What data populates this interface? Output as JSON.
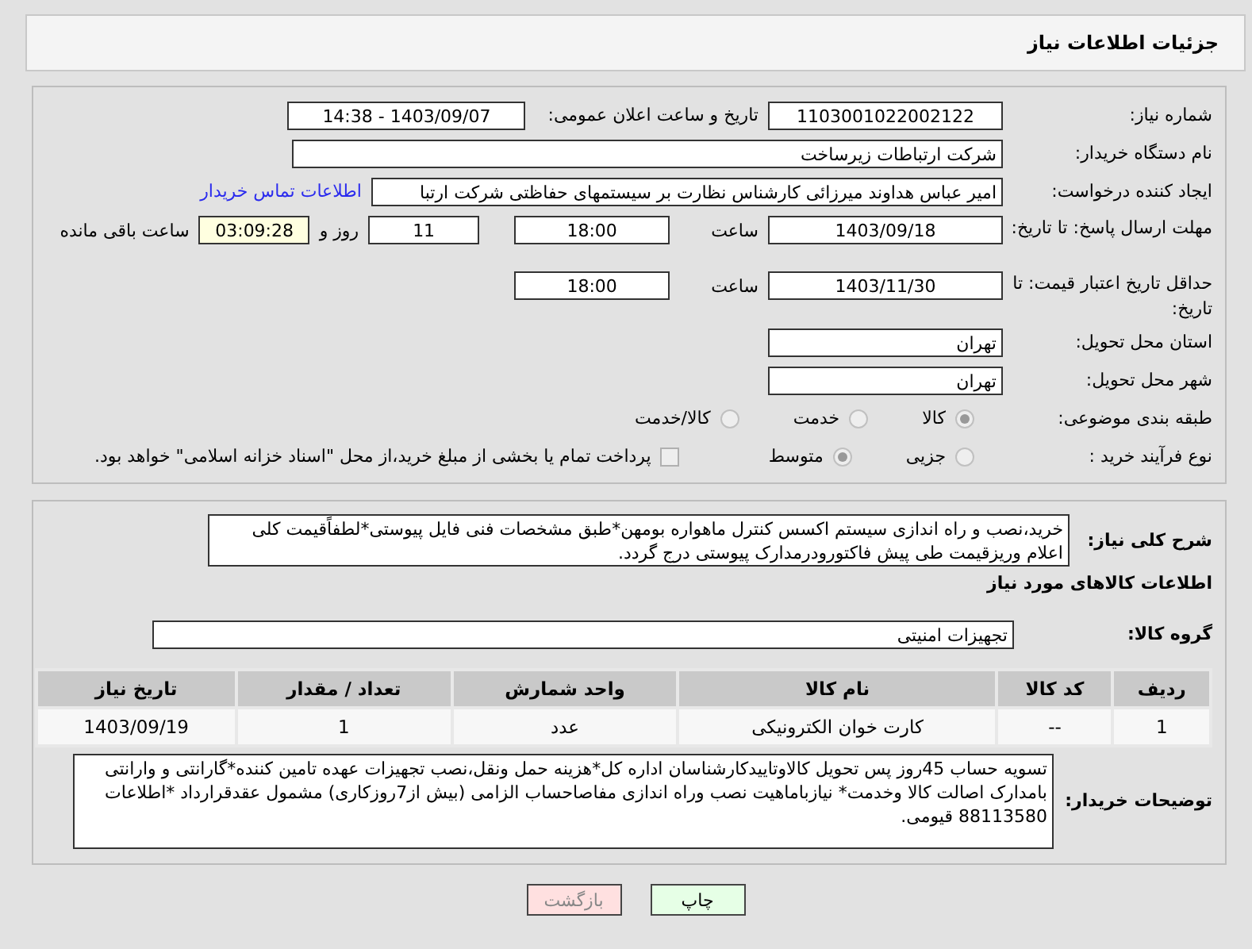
{
  "header": {
    "title": "جزئیات اطلاعات نیاز"
  },
  "need_number": {
    "label": "شماره نیاز:",
    "value": "1103001022002122"
  },
  "announce_datetime": {
    "label": "تاریخ و ساعت اعلان عمومی:",
    "value": "1403/09/07 - 14:38"
  },
  "buyer_org": {
    "label": "نام دستگاه خریدار:",
    "value": "شرکت ارتباطات زیرساخت"
  },
  "requester": {
    "label": "ایجاد کننده درخواست:",
    "value": "امیر عباس هداوند میرزائی کارشناس نظارت بر سیستمهای حفاظتی شرکت ارتبا",
    "link": "اطلاعات تماس خریدار"
  },
  "deadline": {
    "label": "مهلت ارسال پاسخ: تا تاریخ:",
    "date": "1403/09/18",
    "time_label": "ساعت",
    "time": "18:00",
    "days": "11",
    "days_label": "روز و",
    "remaining": "03:09:28",
    "remaining_label": "ساعت باقی مانده"
  },
  "price_validity": {
    "label": "حداقل تاریخ اعتبار قیمت: تا تاریخ:",
    "date": "1403/11/30",
    "time_label": "ساعت",
    "time": "18:00"
  },
  "province": {
    "label": "استان محل تحویل:",
    "value": "تهران"
  },
  "city": {
    "label": "شهر محل تحویل:",
    "value": "تهران"
  },
  "category": {
    "label": "طبقه بندی موضوعی:",
    "options": [
      {
        "label": "کالا",
        "selected": true
      },
      {
        "label": "خدمت",
        "selected": false
      },
      {
        "label": "کالا/خدمت",
        "selected": false
      }
    ]
  },
  "process": {
    "label": "نوع فرآیند خرید :",
    "options": [
      {
        "label": "جزیی",
        "selected": false
      },
      {
        "label": "متوسط",
        "selected": true
      }
    ],
    "treasury": {
      "label": "پرداخت تمام یا بخشی از مبلغ خرید،از محل \"اسناد خزانه اسلامی\" خواهد بود.",
      "checked": false
    }
  },
  "description": {
    "label": "شرح کلی نیاز:",
    "value": "خرید،نصب و راه اندازی سیستم اکسس کنترل ماهواره بومهن*طبق مشخصات فنی فایل پیوستی*لطفاًقیمت کلی اعلام وریزقیمت طی پیش فاکتورودرمدارک پیوستی درج گردد."
  },
  "goods_heading": "اطلاعات کالاهای مورد نیاز",
  "goods_group": {
    "label": "گروه کالا:",
    "value": "تجهیزات امنیتی"
  },
  "table": {
    "columns": [
      "ردیف",
      "کد کالا",
      "نام کالا",
      "واحد شمارش",
      "تعداد / مقدار",
      "تاریخ نیاز"
    ],
    "rows": [
      [
        "1",
        "--",
        "کارت خوان الکترونیکی",
        "عدد",
        "1",
        "1403/09/19"
      ]
    ]
  },
  "buyer_notes": {
    "label": "توضیحات خریدار:",
    "value": "تسویه حساب 45روز پس تحویل کالاوتاییدکارشناسان  اداره کل*هزینه حمل ونقل،نصب تجهیزات عهده تامین کننده*گارانتی و وارانتی بامدارک اصالت کالا وخدمت* نیازباماهیت نصب وراه اندازی مفاصاحساب الزامی (بیش از7روزکاری) مشمول عقدقرارداد *اطلاعات 88113580 قیومی."
  },
  "buttons": [
    {
      "label": "چاپ",
      "kind": "print"
    },
    {
      "label": "بازگشت",
      "kind": "back"
    }
  ]
}
